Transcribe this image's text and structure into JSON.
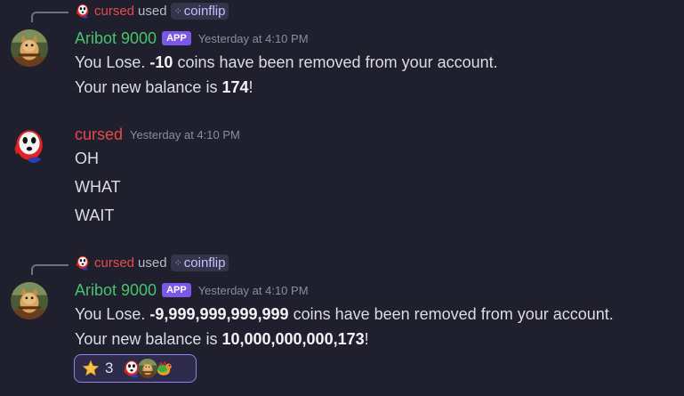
{
  "messages": [
    {
      "reply": {
        "user": "cursed",
        "verb": "used",
        "command": "coinflip",
        "command_icon": "command-icon"
      },
      "author": "Aribot 9000",
      "badge": "APP",
      "timestamp": "Yesterday at 4:10 PM",
      "line1": {
        "pre": "You Lose. ",
        "bold": "-10",
        "post": " coins have been removed from your account."
      },
      "line2": {
        "pre": "Your new balance is ",
        "bold": "174",
        "post": "!"
      }
    },
    {
      "author": "cursed",
      "timestamp": "Yesterday at 4:10 PM",
      "lines": [
        "OH",
        "WHAT",
        "WAIT"
      ]
    },
    {
      "reply": {
        "user": "cursed",
        "verb": "used",
        "command": "coinflip",
        "command_icon": "command-icon"
      },
      "author": "Aribot 9000",
      "badge": "APP",
      "timestamp": "Yesterday at 4:10 PM",
      "line1": {
        "pre": "You Lose. ",
        "bold": "-9,999,999,999,999",
        "post": " coins have been removed from your account."
      },
      "line2": {
        "pre": "Your new balance is ",
        "bold": "10,000,000,000,173",
        "post": "!"
      },
      "reaction": {
        "emoji": "star-icon",
        "count": "3"
      }
    }
  ],
  "colors": {
    "background": "#201f2e",
    "bot_name": "#45c46a",
    "user_name": "#e84a4a",
    "app_badge": "#7b57e6",
    "reaction_border": "#8f82f0"
  }
}
